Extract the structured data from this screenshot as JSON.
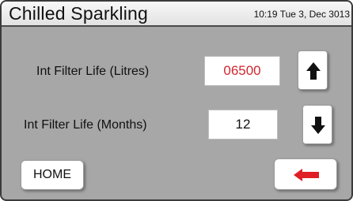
{
  "header": {
    "title": "Chilled Sparkling",
    "clock": "10:19 Tue 3, Dec 3013"
  },
  "settings": [
    {
      "label": "Int Filter Life (Litres)",
      "value": "06500"
    },
    {
      "label": "Int Filter Life (Months)",
      "value": "12"
    }
  ],
  "buttons": {
    "up_icon": "arrow-up-icon",
    "down_icon": "arrow-down-icon",
    "home_label": "HOME",
    "back_icon": "back-arrow-icon"
  },
  "colors": {
    "screen_background": "#a7a7a7",
    "header_background": "#eeeeee",
    "value_highlight": "#d2262e",
    "back_arrow": "#e01e25"
  }
}
